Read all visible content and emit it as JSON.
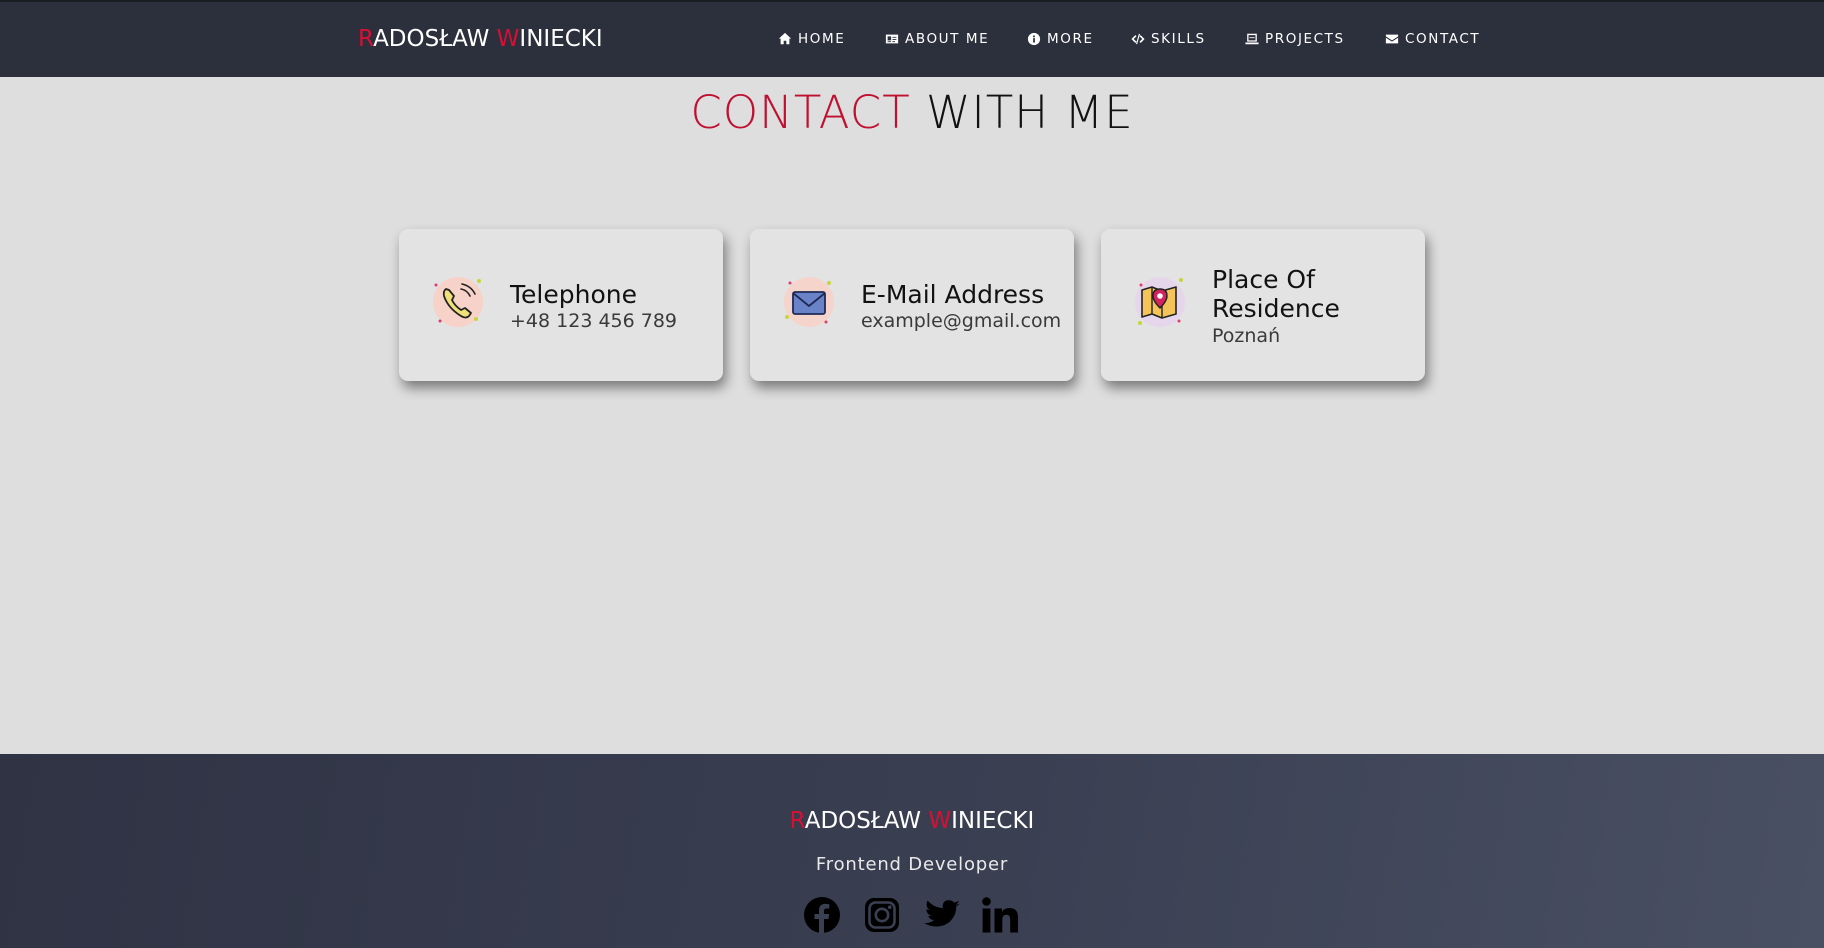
{
  "header": {
    "brand_first_initial": "R",
    "brand_first_rest": "ADOSŁAW ",
    "brand_last_initial": "W",
    "brand_last_rest": "INIECKI",
    "nav": [
      {
        "label": "HOME",
        "icon": "home-icon"
      },
      {
        "label": "ABOUT ME",
        "icon": "id-card-icon"
      },
      {
        "label": "MORE",
        "icon": "info-icon"
      },
      {
        "label": "SKILLS",
        "icon": "code-icon"
      },
      {
        "label": "PROJECTS",
        "icon": "laptop-icon"
      },
      {
        "label": "CONTACT",
        "icon": "envelope-icon"
      }
    ]
  },
  "main": {
    "title_accent": "CONTACT",
    "title_rest": " WITH ME",
    "cards": [
      {
        "title": "Telephone",
        "value": "+48 123 456 789",
        "icon": "phone-icon"
      },
      {
        "title": "E-Mail Address",
        "value": "example@gmail.com",
        "icon": "mail-icon"
      },
      {
        "title": "Place Of Residence",
        "title_line1": "Place Of",
        "title_line2": "Residence",
        "value": "Poznań",
        "icon": "map-pin-icon"
      }
    ]
  },
  "footer": {
    "brand_first_initial": "R",
    "brand_first_rest": "ADOSŁAW ",
    "brand_last_initial": "W",
    "brand_last_rest": "INIECKI",
    "subtitle": "Frontend Developer",
    "social": [
      "facebook-icon",
      "instagram-icon",
      "twitter-icon",
      "linkedin-icon"
    ]
  },
  "colors": {
    "accent": "#d80f34",
    "header_bg": "#2c2f3c",
    "page_bg": "#dedede",
    "card_bg": "#e3e3e3"
  }
}
